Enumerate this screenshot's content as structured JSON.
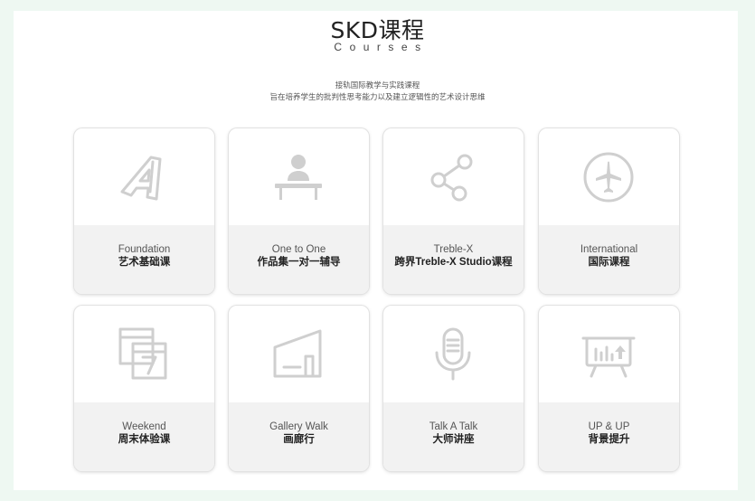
{
  "header": {
    "title": "SKD课程",
    "subtitle": "Courses",
    "desc_line1": "接轨国际教学与实践课程",
    "desc_line2": "旨在培养学生的批判性思考能力以及建立逻辑性的艺术设计思维"
  },
  "courses": [
    {
      "en": "Foundation",
      "cn": "艺术基础课",
      "icon": "letter-a-icon"
    },
    {
      "en": "One to One",
      "cn": "作品集一对一辅导",
      "icon": "person-desk-icon"
    },
    {
      "en": "Treble-X",
      "cn": "跨界Treble-X Studio课程",
      "icon": "share-nodes-icon"
    },
    {
      "en": "International",
      "cn": "国际课程",
      "icon": "airplane-icon"
    },
    {
      "en": "Weekend",
      "cn": "周末体验课",
      "icon": "calendar-icon"
    },
    {
      "en": "Gallery Walk",
      "cn": "画廊行",
      "icon": "gallery-building-icon"
    },
    {
      "en": "Talk A Talk",
      "cn": "大师讲座",
      "icon": "microphone-icon"
    },
    {
      "en": "UP & UP",
      "cn": "背景提升",
      "icon": "presentation-board-icon"
    }
  ],
  "colors": {
    "page_background": "#eef8f2",
    "card_label_background": "#f2f2f2",
    "icon": "#cfcfcf"
  }
}
